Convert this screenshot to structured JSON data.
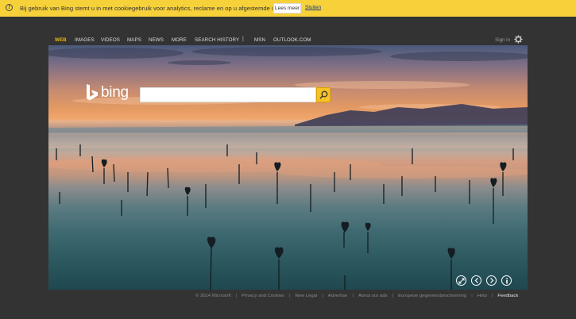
{
  "cookie": {
    "info_icon": "info-icon",
    "text": "Bij gebruik van Bing stemt u in met cookiegebruik voor analytics, reclame en op u afgestemde inhoud",
    "more_button": "Lees meer",
    "close_link": "Sluiten"
  },
  "nav": {
    "items": [
      "WEB",
      "IMAGES",
      "VIDEOS",
      "MAPS",
      "NEWS",
      "MORE",
      "SEARCH HISTORY",
      "MSN",
      "OUTLOOK.COM"
    ],
    "separator": "|",
    "signin": "Sign in",
    "settings_icon": "gear-icon"
  },
  "logo": {
    "text": "bing"
  },
  "search": {
    "value": "",
    "button_icon": "search-icon"
  },
  "controls": [
    "expand-icon",
    "chevron-left-icon",
    "chevron-right-icon",
    "info-icon"
  ],
  "footer": {
    "items": [
      "© 2014 Microsoft",
      "Privacy and Cookies",
      "New Legal",
      "Advertise",
      "About our ads",
      "Europese gegevensbescherming",
      "Help",
      "Feedback"
    ],
    "separator": "|"
  },
  "colors": {
    "accent": "#f7c226",
    "cookie_bar": "#f7d13a",
    "background": "#333333"
  }
}
